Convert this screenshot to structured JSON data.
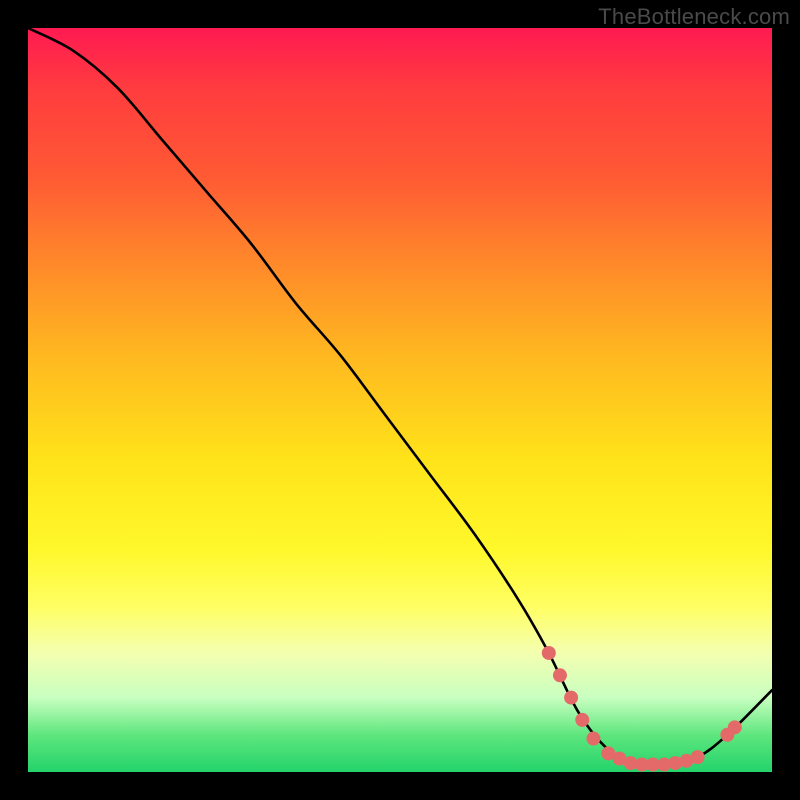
{
  "watermark": "TheBottleneck.com",
  "chart_data": {
    "type": "line",
    "title": "",
    "xlabel": "",
    "ylabel": "",
    "xlim": [
      0,
      100
    ],
    "ylim": [
      0,
      100
    ],
    "series": [
      {
        "name": "bottleneck-curve",
        "color": "#000000",
        "x": [
          0,
          6,
          12,
          18,
          24,
          30,
          36,
          42,
          48,
          54,
          60,
          66,
          70,
          74,
          78,
          82,
          86,
          90,
          94,
          100
        ],
        "y": [
          100,
          97,
          92,
          85,
          78,
          71,
          63,
          56,
          48,
          40,
          32,
          23,
          16,
          8,
          3,
          1,
          1,
          2,
          5,
          11
        ]
      }
    ],
    "markers": {
      "name": "highlight-dots",
      "color": "#e46a6a",
      "radius": 7,
      "points": [
        {
          "x": 70,
          "y": 16
        },
        {
          "x": 71.5,
          "y": 13
        },
        {
          "x": 73,
          "y": 10
        },
        {
          "x": 74.5,
          "y": 7
        },
        {
          "x": 76,
          "y": 4.5
        },
        {
          "x": 78,
          "y": 2.5
        },
        {
          "x": 79.5,
          "y": 1.8
        },
        {
          "x": 81,
          "y": 1.2
        },
        {
          "x": 82.5,
          "y": 1
        },
        {
          "x": 84,
          "y": 1
        },
        {
          "x": 85.5,
          "y": 1
        },
        {
          "x": 87,
          "y": 1.2
        },
        {
          "x": 88.5,
          "y": 1.5
        },
        {
          "x": 90,
          "y": 2
        },
        {
          "x": 94,
          "y": 5
        },
        {
          "x": 95,
          "y": 6
        }
      ]
    }
  }
}
